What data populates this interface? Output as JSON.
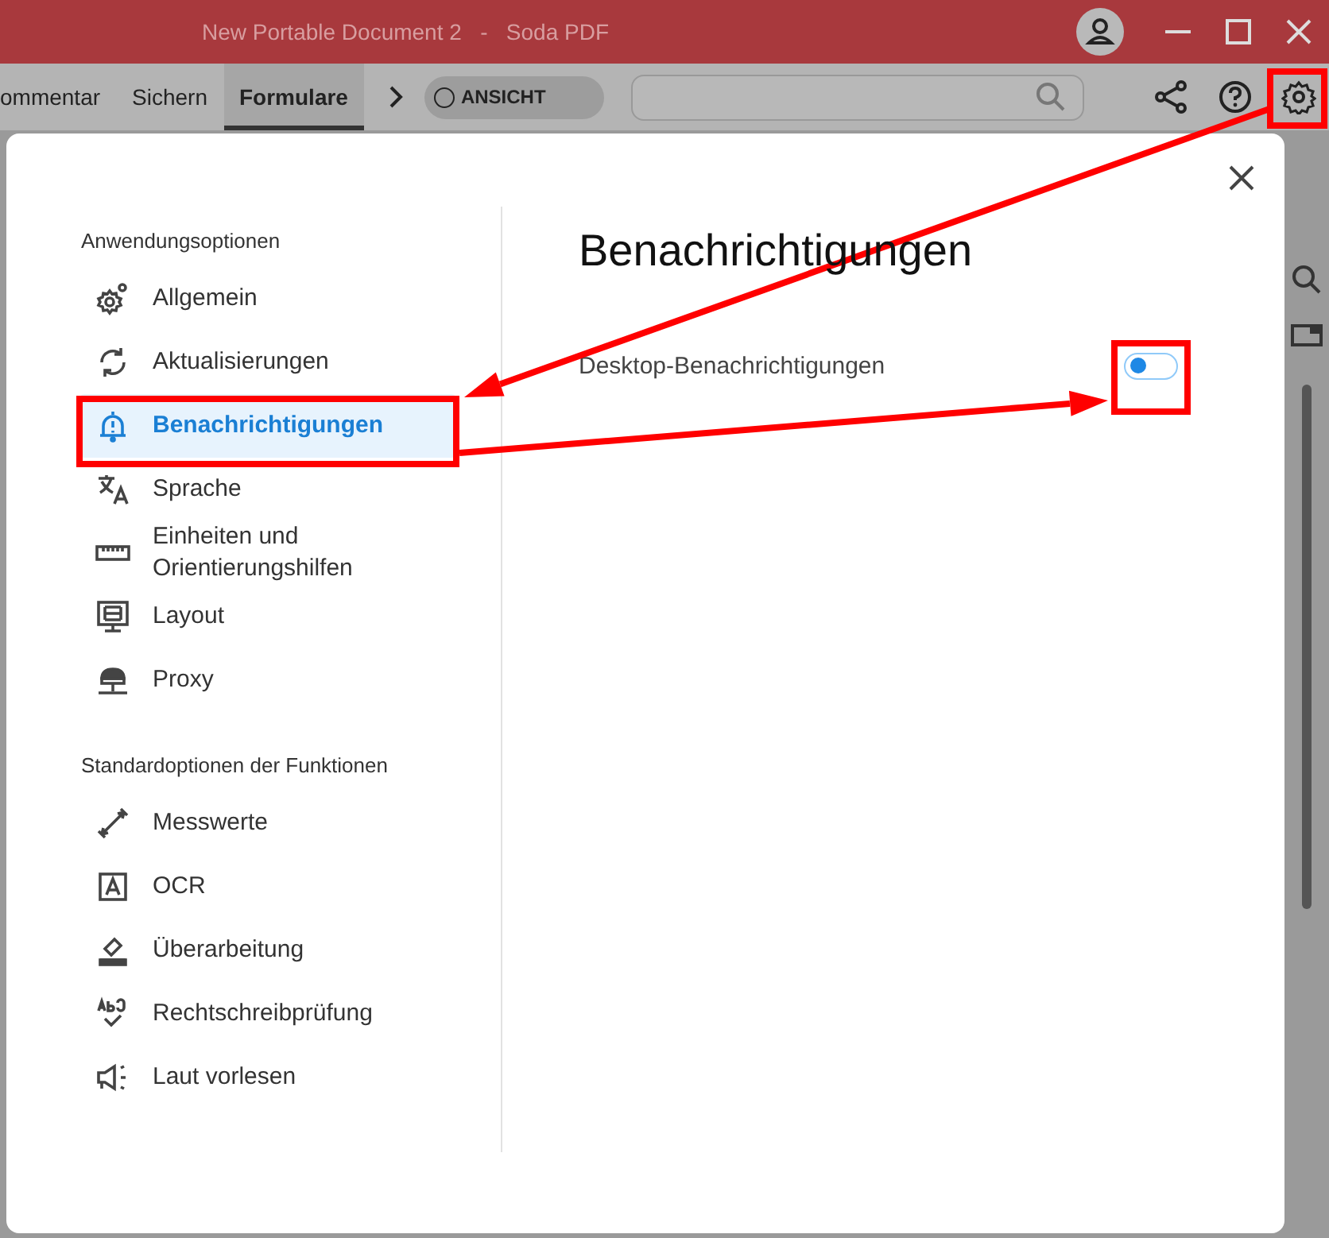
{
  "window": {
    "title": "New Portable Document 2   -   Soda PDF"
  },
  "toolbar": {
    "tabs": [
      {
        "label": "ommentar",
        "selected": false
      },
      {
        "label": "Sichern",
        "selected": false
      },
      {
        "label": "Formulare",
        "selected": true
      }
    ],
    "view_toggle": {
      "label": "ANSICHT",
      "on": false
    }
  },
  "dialog": {
    "title": "Benachrichtigungen",
    "sections": [
      {
        "heading": "Anwendungsoptionen",
        "items": [
          {
            "label": "Allgemein",
            "selected": false
          },
          {
            "label": "Aktualisierungen",
            "selected": false
          },
          {
            "label": "Benachrichtigungen",
            "selected": true
          },
          {
            "label": "Sprache",
            "selected": false
          },
          {
            "label": "Einheiten und Orientierungshilfen",
            "selected": false
          },
          {
            "label": "Layout",
            "selected": false
          },
          {
            "label": "Proxy",
            "selected": false
          }
        ]
      },
      {
        "heading": "Standardoptionen der Funktionen",
        "items": [
          {
            "label": "Messwerte",
            "selected": false
          },
          {
            "label": "OCR",
            "selected": false
          },
          {
            "label": "Überarbeitung",
            "selected": false
          },
          {
            "label": "Rechtschreibprüfung",
            "selected": false
          },
          {
            "label": "Laut vorlesen",
            "selected": false
          }
        ]
      }
    ],
    "settings": [
      {
        "label": "Desktop-Benachrichtigungen",
        "on": false
      }
    ]
  }
}
